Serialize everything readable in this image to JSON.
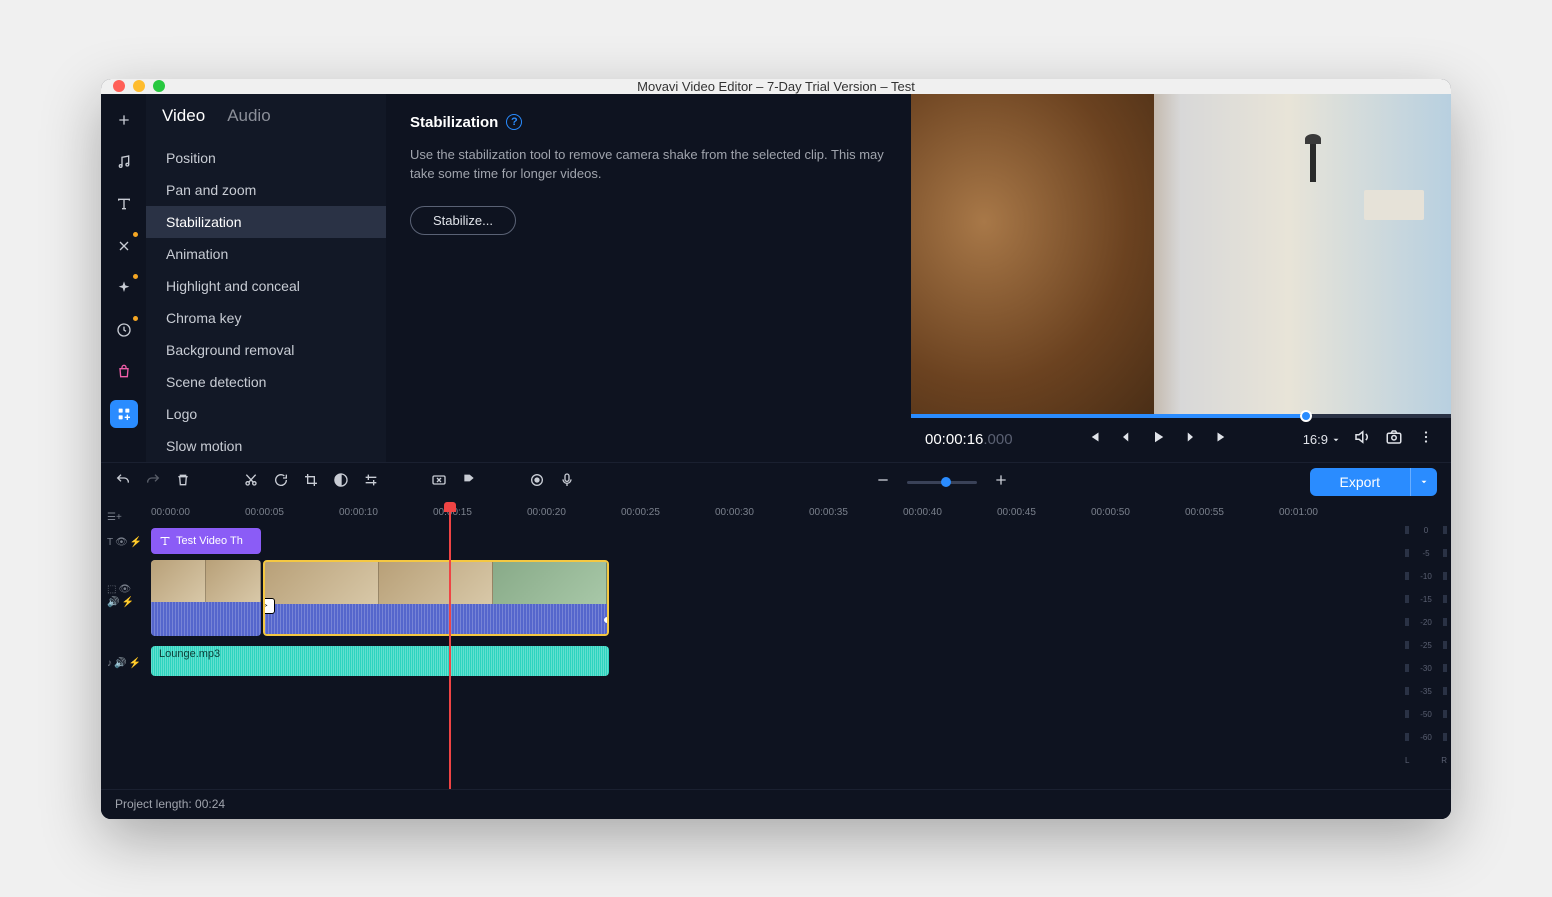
{
  "window": {
    "title": "Movavi Video Editor – 7-Day Trial Version – Test"
  },
  "traffic": {
    "close": "#ff5f57",
    "min": "#febc2e",
    "max": "#28c840"
  },
  "rail": [
    {
      "name": "plus-icon"
    },
    {
      "name": "music-icon"
    },
    {
      "name": "text-icon"
    },
    {
      "name": "transitions-icon",
      "dot": true
    },
    {
      "name": "effects-icon",
      "dot": true
    },
    {
      "name": "clock-icon",
      "dot": true
    },
    {
      "name": "bag-icon",
      "color": "#ef5da8"
    },
    {
      "name": "apps-icon",
      "active": true
    }
  ],
  "panel": {
    "tabs": {
      "video": "Video",
      "audio": "Audio",
      "active": "video"
    },
    "items": [
      "Position",
      "Pan and zoom",
      "Stabilization",
      "Animation",
      "Highlight and conceal",
      "Chroma key",
      "Background removal",
      "Scene detection",
      "Logo",
      "Slow motion"
    ],
    "active_index": 2
  },
  "content": {
    "title": "Stabilization",
    "desc": "Use the stabilization tool to remove camera shake from the selected clip. This may take some time for longer videos.",
    "button": "Stabilize..."
  },
  "preview": {
    "timecode": "00:00:16",
    "timecode_ms": ".000",
    "aspect": "16:9"
  },
  "toolbar": {
    "export": "Export"
  },
  "timeline": {
    "ruler": [
      "00:00:00",
      "00:00:05",
      "00:00:10",
      "00:00:15",
      "00:00:20",
      "00:00:25",
      "00:00:30",
      "00:00:35",
      "00:00:40",
      "00:00:45",
      "00:00:50",
      "00:00:55",
      "00:01:00"
    ],
    "title_clip": "Test Video Th",
    "audio_clip": "Lounge.mp3",
    "meters": [
      "0",
      "-5",
      "-10",
      "-15",
      "-20",
      "-25",
      "-30",
      "-35",
      "-50",
      "-60"
    ],
    "lr": {
      "l": "L",
      "r": "R"
    }
  },
  "footer": {
    "length": "Project length: 00:24"
  }
}
